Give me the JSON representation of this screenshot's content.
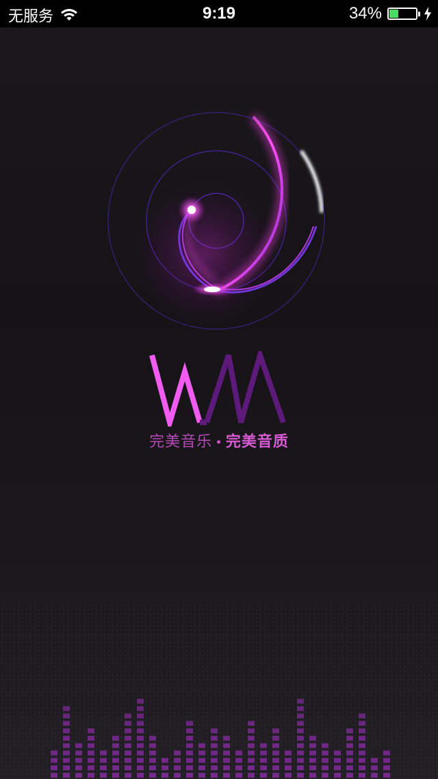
{
  "status_bar": {
    "carrier": "无服务",
    "time": "9:19",
    "battery_percent_text": "34%",
    "battery_level": 0.34,
    "battery_color": "#4cd964",
    "wifi_icon": "wifi-icon",
    "charging_icon": "charging-bolt-icon"
  },
  "logo": {
    "wordmark_letters": "WM",
    "wordmark_color_w": "#ef5cef",
    "wordmark_color_m": "#5e1a7a",
    "swirl_color": "#e23ce6"
  },
  "tagline": {
    "part1": "完美音乐",
    "separator": "•",
    "part2": "完美音质"
  },
  "equalizer": {
    "levels": [
      4,
      10,
      5,
      7,
      4,
      6,
      9,
      11,
      6,
      3,
      4,
      8,
      5,
      7,
      6,
      4,
      8,
      5,
      7,
      4,
      11,
      6,
      5,
      4,
      7,
      9,
      3,
      4
    ],
    "color": "#7a2a92"
  }
}
